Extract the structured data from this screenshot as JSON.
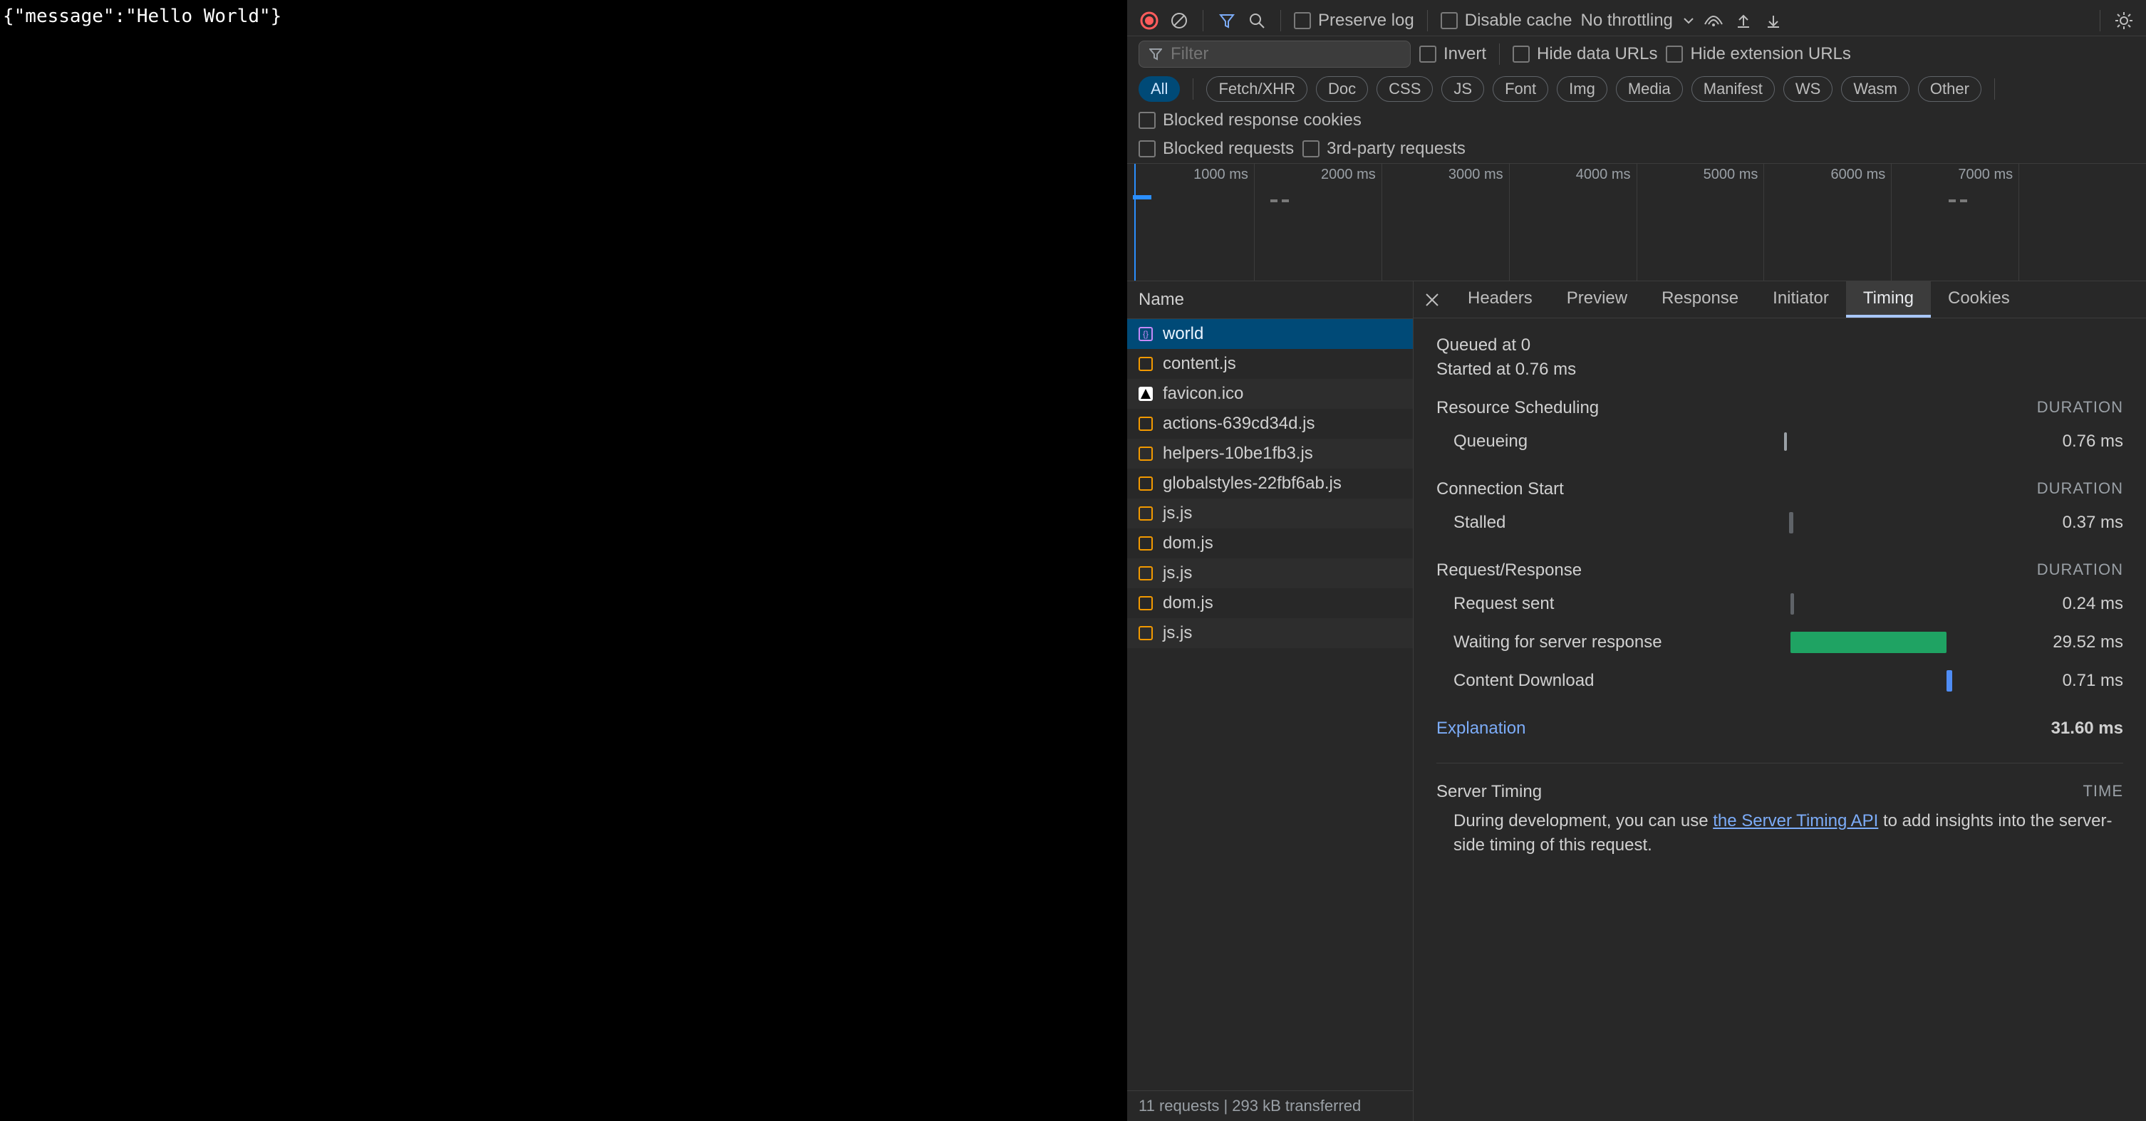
{
  "page_content": "{\"message\":\"Hello World\"}",
  "toolbar": {
    "preserve_log": "Preserve log",
    "disable_cache": "Disable cache",
    "throttling": "No throttling"
  },
  "filter": {
    "placeholder": "Filter",
    "invert": "Invert",
    "hide_data": "Hide data URLs",
    "hide_ext": "Hide extension URLs"
  },
  "types": [
    "All",
    "Fetch/XHR",
    "Doc",
    "CSS",
    "JS",
    "Font",
    "Img",
    "Media",
    "Manifest",
    "WS",
    "Wasm",
    "Other"
  ],
  "type_extras": {
    "blocked_cookies": "Blocked response cookies",
    "blocked_requests": "Blocked requests",
    "third_party": "3rd-party requests"
  },
  "waterfall_ticks": [
    "1000 ms",
    "2000 ms",
    "3000 ms",
    "4000 ms",
    "5000 ms",
    "6000 ms",
    "7000 ms"
  ],
  "requests": {
    "column": "Name",
    "items": [
      {
        "name": "world",
        "icon": "json",
        "selected": true
      },
      {
        "name": "content.js",
        "icon": "js"
      },
      {
        "name": "favicon.ico",
        "icon": "fav"
      },
      {
        "name": "actions-639cd34d.js",
        "icon": "js"
      },
      {
        "name": "helpers-10be1fb3.js",
        "icon": "js"
      },
      {
        "name": "globalstyles-22fbf6ab.js",
        "icon": "js"
      },
      {
        "name": "js.js",
        "icon": "js"
      },
      {
        "name": "dom.js",
        "icon": "js"
      },
      {
        "name": "js.js",
        "icon": "js"
      },
      {
        "name": "dom.js",
        "icon": "js"
      },
      {
        "name": "js.js",
        "icon": "js"
      }
    ],
    "footer": "11 requests   |   293 kB transferred"
  },
  "detail_tabs": [
    "Headers",
    "Preview",
    "Response",
    "Initiator",
    "Timing",
    "Cookies"
  ],
  "timing": {
    "queued": "Queued at 0",
    "started": "Started at 0.76 ms",
    "sections": {
      "resource": "Resource Scheduling",
      "connection": "Connection Start",
      "reqresp": "Request/Response"
    },
    "duration_label": "DURATION",
    "rows": {
      "queueing": {
        "label": "Queueing",
        "value": "0.76 ms"
      },
      "stalled": {
        "label": "Stalled",
        "value": "0.37 ms"
      },
      "sent": {
        "label": "Request sent",
        "value": "0.24 ms"
      },
      "waiting": {
        "label": "Waiting for server response",
        "value": "29.52 ms"
      },
      "download": {
        "label": "Content Download",
        "value": "0.71 ms"
      }
    },
    "explanation": "Explanation",
    "total": "31.60 ms",
    "server_timing_h": "Server Timing",
    "time_label": "TIME",
    "server_pre": "During development, you can use ",
    "server_link": "the Server Timing API",
    "server_post": " to add insights into the server-side timing of this request."
  }
}
